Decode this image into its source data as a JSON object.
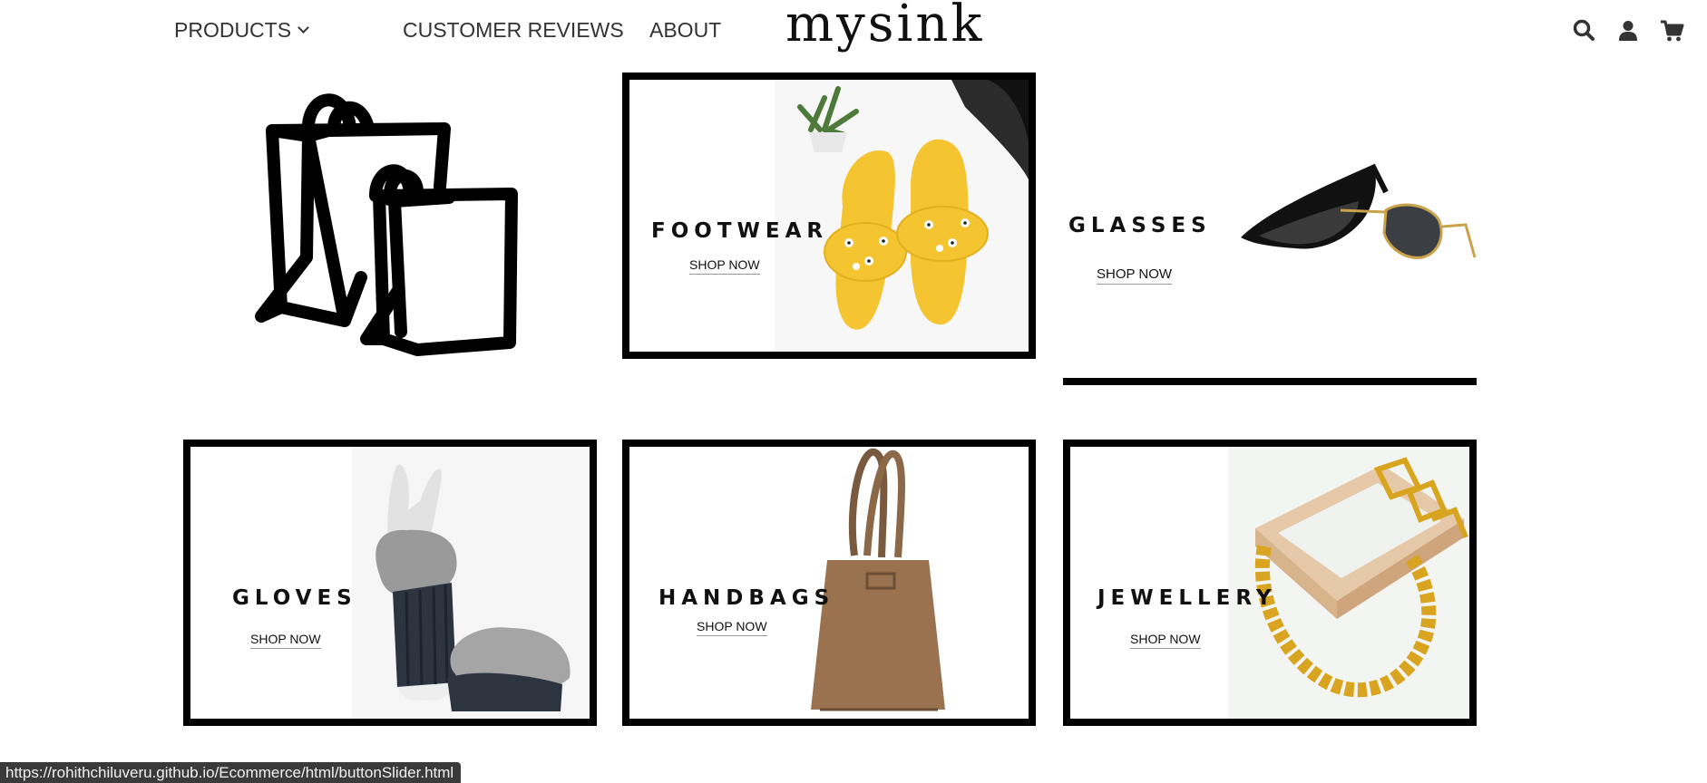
{
  "nav": {
    "products_label": "PRODUCTS",
    "reviews_label": "CUSTOMER REVIEWS",
    "about_label": "ABOUT",
    "logo": "mysink",
    "icons": [
      "search-icon",
      "user-icon",
      "cart-icon"
    ]
  },
  "categories": [
    {
      "title": "FOOTWEAR",
      "cta": "SHOP NOW"
    },
    {
      "title": "GLASSES",
      "cta": "SHOP NOW"
    },
    {
      "title": "GLOVES",
      "cta": "SHOP NOW"
    },
    {
      "title": "HANDBAGS",
      "cta": "SHOP NOW"
    },
    {
      "title": "JEWELLERY",
      "cta": "SHOP NOW"
    }
  ],
  "status_bar": {
    "url": "https://rohithchiluveru.github.io/Ecommerce/html/buttonSlider.html"
  },
  "colors": {
    "border": "#000000",
    "footwear_yellow": "#f4c431",
    "handbag_brown": "#9a7250",
    "jewel_gold": "#d9a520",
    "background": "#ffffff"
  }
}
